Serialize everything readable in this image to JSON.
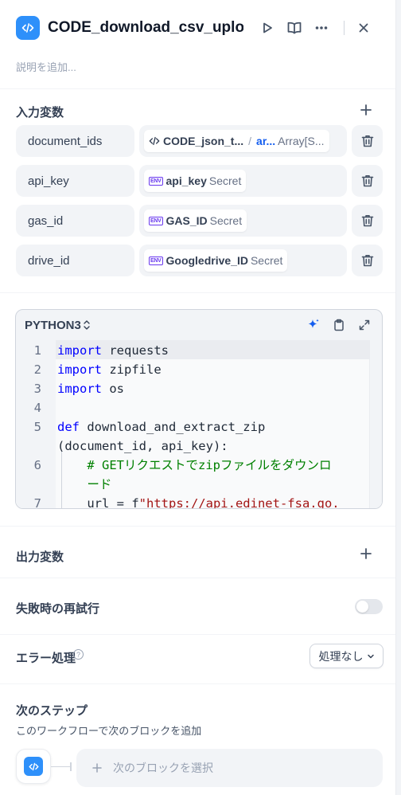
{
  "header": {
    "title": "CODE_download_csv_uploa",
    "description_placeholder": "説明を追加..."
  },
  "input_vars": {
    "title": "入力変数",
    "rows": [
      {
        "name": "document_ids",
        "source_node": "CODE_json_t...",
        "source_var": "ar...",
        "type": "Array[S..."
      },
      {
        "name": "api_key",
        "value": "api_key",
        "type": "Secret"
      },
      {
        "name": "gas_id",
        "value": "GAS_ID",
        "type": "Secret"
      },
      {
        "name": "drive_id",
        "value": "Googledrive_ID",
        "type": "Secret"
      }
    ]
  },
  "code": {
    "language": "PYTHON3",
    "lines": [
      {
        "n": "1",
        "segments": [
          {
            "t": "import",
            "c": "kw"
          },
          {
            "t": " requests",
            "c": ""
          }
        ]
      },
      {
        "n": "2",
        "segments": [
          {
            "t": "import",
            "c": "kw"
          },
          {
            "t": " zipfile",
            "c": ""
          }
        ]
      },
      {
        "n": "3",
        "segments": [
          {
            "t": "import",
            "c": "kw"
          },
          {
            "t": " os",
            "c": ""
          }
        ]
      },
      {
        "n": "4",
        "segments": []
      },
      {
        "n": "5",
        "segments": [
          {
            "t": "def",
            "c": "kw"
          },
          {
            "t": " download_and_extract_zip",
            "c": ""
          }
        ]
      },
      {
        "n": "",
        "segments": [
          {
            "t": "(document_id, api_key):",
            "c": ""
          }
        ]
      },
      {
        "n": "6",
        "segments": [
          {
            "t": "    # GETリクエストでzipファイルをダウンロ",
            "c": "cm"
          }
        ]
      },
      {
        "n": "",
        "segments": [
          {
            "t": "    ード",
            "c": "cm"
          }
        ]
      },
      {
        "n": "7",
        "segments": [
          {
            "t": "    url = f",
            "c": ""
          },
          {
            "t": "\"https://api.edinet-fsa.go.",
            "c": "st"
          }
        ]
      }
    ]
  },
  "output_vars": {
    "title": "出力変数"
  },
  "retry": {
    "title": "失敗時の再試行",
    "enabled": false
  },
  "error_handling": {
    "title": "エラー処理",
    "selected": "処理なし"
  },
  "next_step": {
    "title": "次のステップ",
    "description": "このワークフローで次のブロックを追加",
    "select_label": "次のブロックを選択"
  }
}
